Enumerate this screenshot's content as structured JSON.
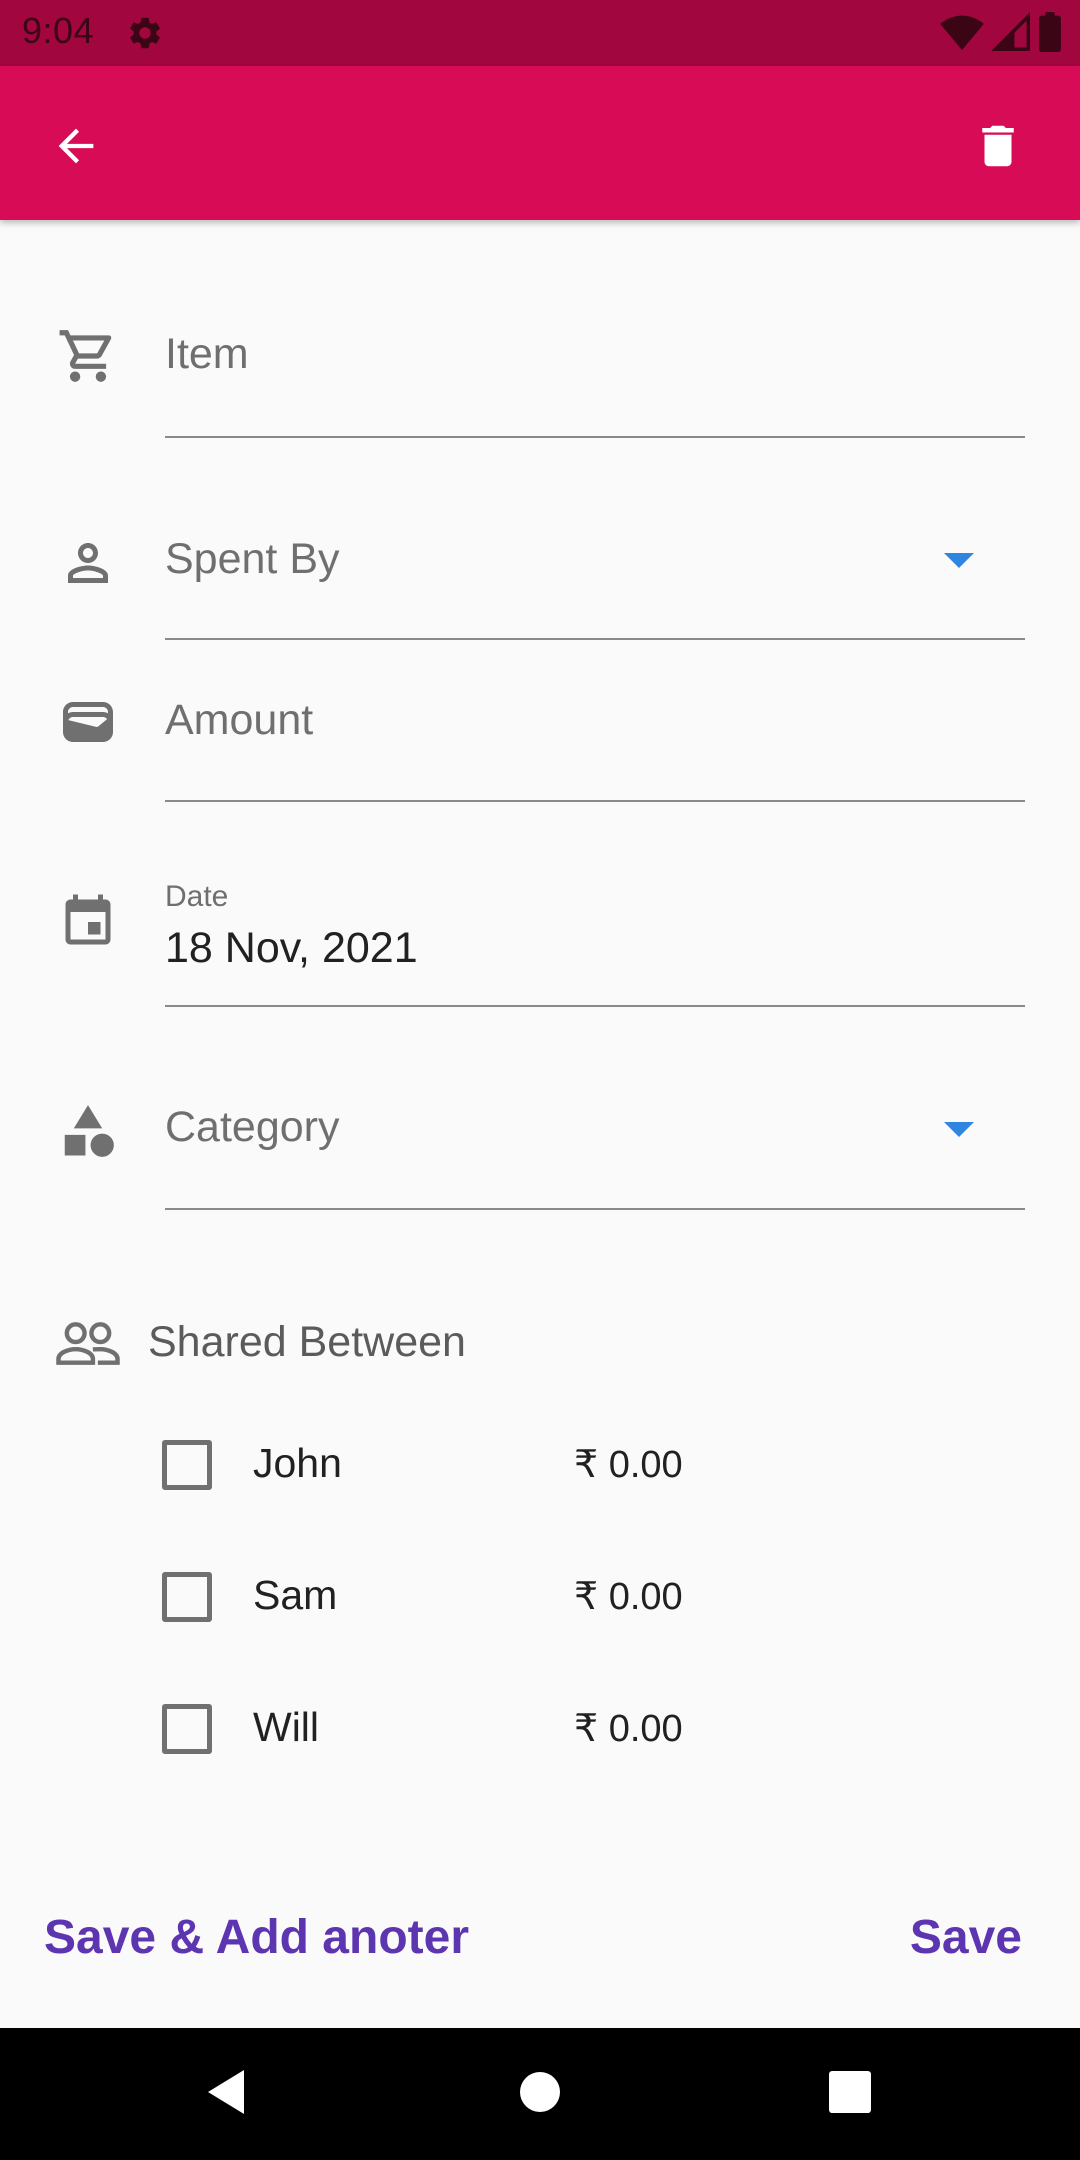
{
  "status_bar": {
    "time": "9:04",
    "icons": [
      "settings-gear-icon",
      "wifi-icon",
      "cellular-signal-icon",
      "battery-icon"
    ]
  },
  "app_bar": {
    "color": "#d80b56",
    "back_icon": "arrow-back-icon",
    "delete_icon": "trash-icon"
  },
  "form": {
    "item": {
      "placeholder": "Item",
      "icon": "cart-icon"
    },
    "spent_by": {
      "placeholder": "Spent By",
      "icon": "person-icon"
    },
    "amount": {
      "placeholder": "Amount",
      "icon": "wallet-icon"
    },
    "date": {
      "label": "Date",
      "value": "18 Nov, 2021",
      "icon": "calendar-icon"
    },
    "category": {
      "placeholder": "Category",
      "icon": "shapes-icon"
    }
  },
  "shared": {
    "title": "Shared Between",
    "icon": "people-icon",
    "members": [
      {
        "name": "John",
        "amount": "₹ 0.00",
        "checked": false
      },
      {
        "name": "Sam",
        "amount": "₹ 0.00",
        "checked": false
      },
      {
        "name": "Will",
        "amount": "₹ 0.00",
        "checked": false
      }
    ]
  },
  "actions": {
    "save_add": "Save & Add anoter",
    "save": "Save",
    "color": "#5e35b1"
  },
  "nav": {
    "icons": [
      "back-triangle-icon",
      "home-circle-icon",
      "recents-square-icon"
    ]
  }
}
